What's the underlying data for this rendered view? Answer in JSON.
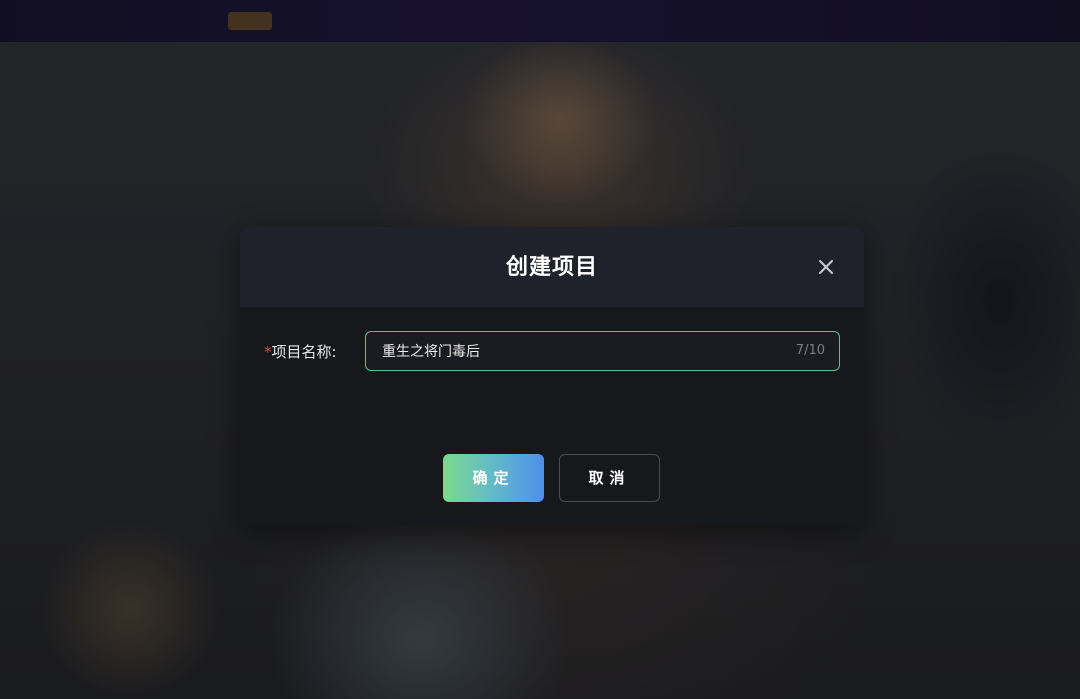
{
  "dialog": {
    "title": "创建项目",
    "close_icon": "close-icon",
    "field": {
      "required_mark": "*",
      "label": "项目名称:",
      "value": "重生之将门毒后",
      "counter": "7/10"
    },
    "buttons": {
      "confirm": "确定",
      "cancel": "取消"
    }
  },
  "colors": {
    "input_border": "#5fbf86",
    "confirm_gradient_start": "#7bd98c",
    "confirm_gradient_end": "#4f8fec",
    "required": "#e5484d"
  }
}
